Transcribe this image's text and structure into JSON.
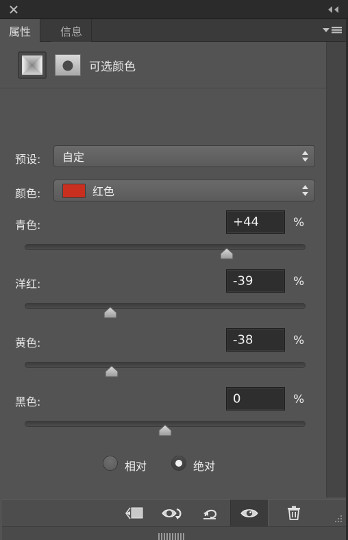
{
  "window": {
    "close_icon": "close-icon",
    "collapse_icon": "collapse-double-chevron-icon"
  },
  "tabs": [
    {
      "label": "属性",
      "name": "tab-properties",
      "active": true
    },
    {
      "label": "信息",
      "name": "tab-info",
      "active": false
    }
  ],
  "panel_menu_icon": "panel-menu-icon",
  "adjustment": {
    "icon": "selective-color-adjustment-icon",
    "mask_thumbnail": "layer-mask-thumbnail",
    "title": "可选颜色"
  },
  "preset": {
    "label": "预设:",
    "value": "自定"
  },
  "colors": {
    "label": "颜色:",
    "value": "红色",
    "swatch_color": "#c92f1f"
  },
  "sliders": [
    {
      "label": "青色:",
      "value": "+44",
      "unit": "%",
      "percent": 72
    },
    {
      "label": "洋红:",
      "value": "-39",
      "unit": "%",
      "percent": 30.5
    },
    {
      "label": "黄色:",
      "value": "-38",
      "unit": "%",
      "percent": 31
    },
    {
      "label": "黑色:",
      "value": "0",
      "unit": "%",
      "percent": 50
    }
  ],
  "method": {
    "relative": {
      "label": "相对",
      "selected": false
    },
    "absolute": {
      "label": "绝对",
      "selected": true
    }
  },
  "toolbar": [
    {
      "name": "clip-to-layer-icon",
      "pressed": false
    },
    {
      "name": "toggle-previous-state-icon",
      "pressed": false
    },
    {
      "name": "reset-icon",
      "pressed": false
    },
    {
      "name": "visibility-eye-icon",
      "pressed": true
    },
    {
      "name": "delete-trash-icon",
      "pressed": false
    }
  ],
  "resize_grip_icon": "resize-grip-icon",
  "drag_handle_icon": "drag-handle-icon",
  "theme": {
    "panel_bg": "#535353",
    "titlebar_bg": "#2b2b2b",
    "tab_inactive_bg": "#3a3a3a",
    "text": "#e8e8e8",
    "value_box_bg": "#2e2e2e"
  }
}
